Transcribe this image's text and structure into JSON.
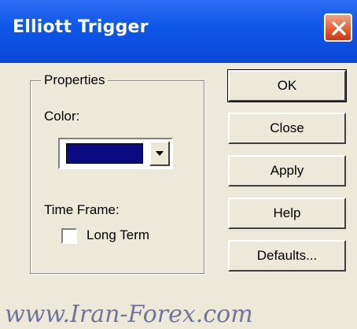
{
  "window": {
    "title": "Elliott Trigger",
    "close_icon": "close-icon"
  },
  "properties": {
    "group_label": "Properties",
    "color_label": "Color:",
    "color_value": "#0A0A82",
    "timeframe_label": "Time Frame:",
    "long_term_label": "Long Term",
    "long_term_checked": false
  },
  "buttons": {
    "ok": "OK",
    "close": "Close",
    "apply": "Apply",
    "help": "Help",
    "defaults": "Defaults..."
  },
  "watermark": "www.Iran-Forex.com"
}
